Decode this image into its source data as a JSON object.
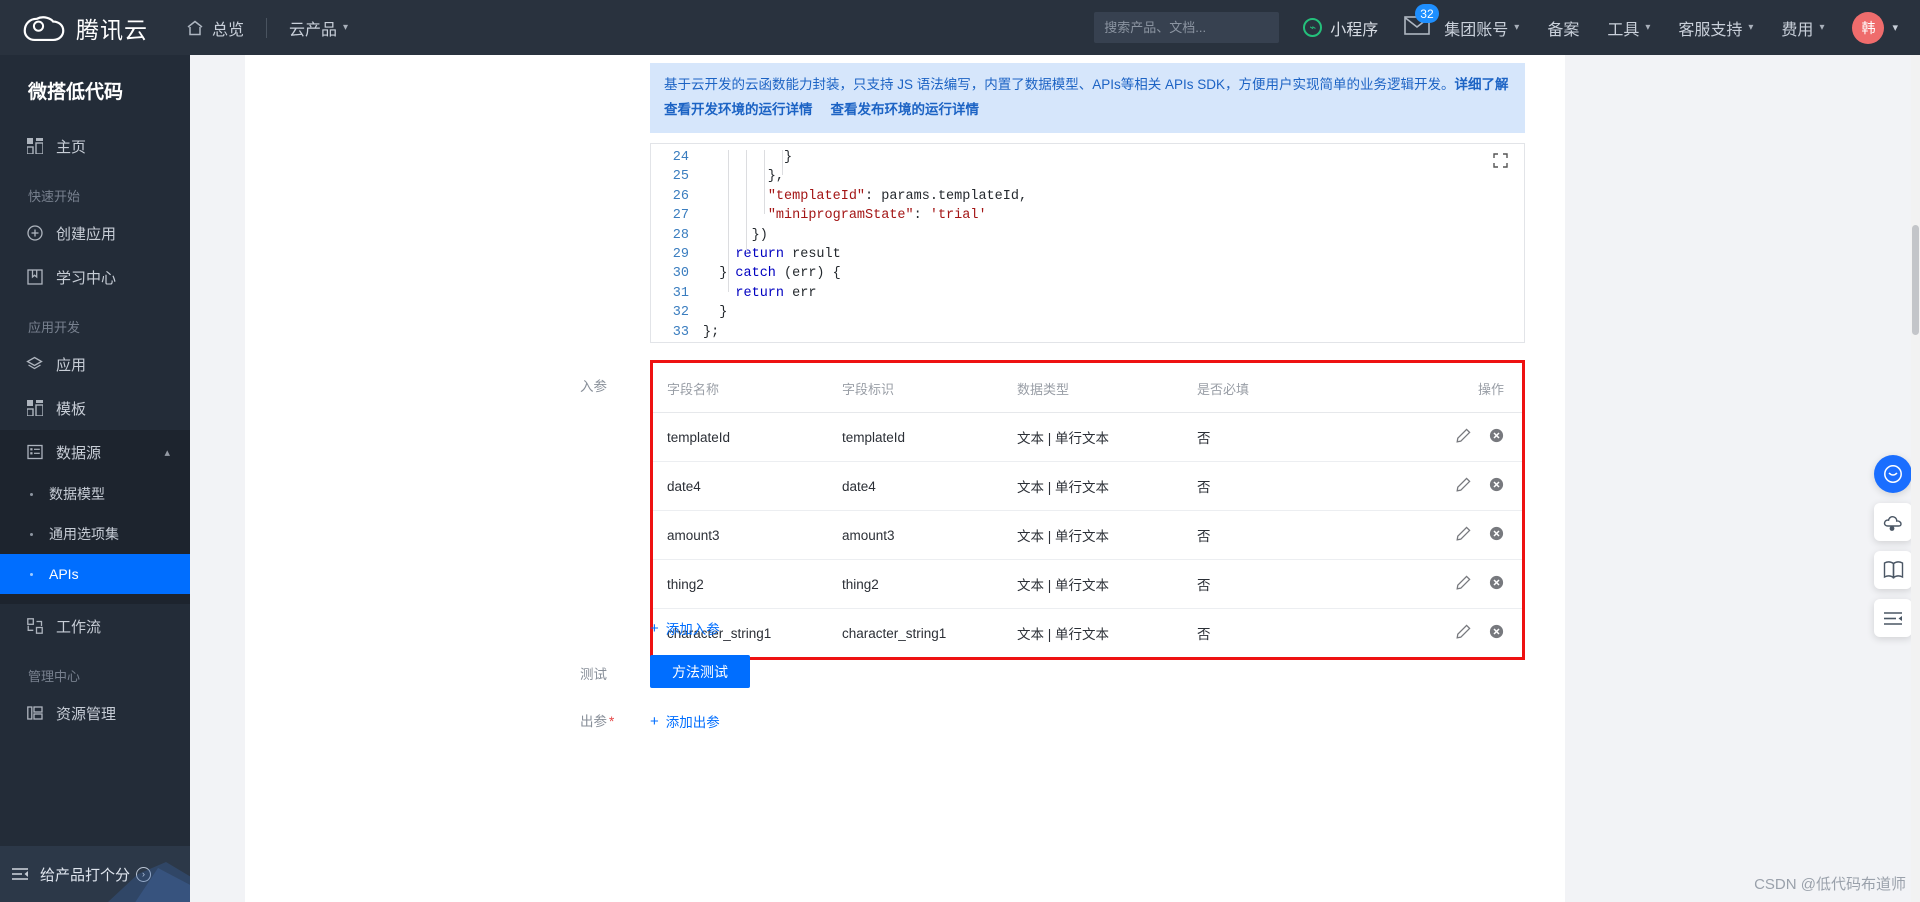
{
  "header": {
    "brand": "腾讯云",
    "home": "总览",
    "products": "云产品",
    "search_placeholder": "搜索产品、文档...",
    "miniprogram": "小程序",
    "mail_badge": "32",
    "group_account": "集团账号",
    "beian": "备案",
    "tools": "工具",
    "support": "客服支持",
    "fee": "费用",
    "avatar_text": "韩"
  },
  "sidebar": {
    "title": "微搭低代码",
    "home": "主页",
    "group_quickstart": "快速开始",
    "create_app": "创建应用",
    "learn_center": "学习中心",
    "group_appdev": "应用开发",
    "app": "应用",
    "template": "模板",
    "datasource": "数据源",
    "data_model": "数据模型",
    "option_set": "通用选项集",
    "apis": "APIs",
    "workflow": "工作流",
    "group_manage": "管理中心",
    "resource_manage": "资源管理",
    "rate_product": "给产品打个分"
  },
  "notice": {
    "text": "基于云开发的云函数能力封装，只支持 JS 语法编写，内置了数据模型、APIs等相关 APIs SDK，方便用户实现简单的业务逻辑开发。",
    "detail_link": "详细了解",
    "dev_env_link": "查看开发环境的运行详情",
    "release_env_link": "查看发布环境的运行详情"
  },
  "code": {
    "lines": [
      {
        "no": "24",
        "text": "          }"
      },
      {
        "no": "25",
        "text": "        },"
      },
      {
        "no": "26",
        "text": "        \"templateId\": params.templateId,"
      },
      {
        "no": "27",
        "text": "        \"miniprogramState\": 'trial'"
      },
      {
        "no": "28",
        "text": "      })"
      },
      {
        "no": "29",
        "text": "    return result"
      },
      {
        "no": "30",
        "text": "  } catch (err) {"
      },
      {
        "no": "31",
        "text": "    return err"
      },
      {
        "no": "32",
        "text": "  }"
      },
      {
        "no": "33",
        "text": "};"
      }
    ]
  },
  "params": {
    "label": "入参",
    "columns": [
      "字段名称",
      "字段标识",
      "数据类型",
      "是否必填",
      "操作"
    ],
    "rows": [
      {
        "name": "templateId",
        "key": "templateId",
        "type": "文本 | 单行文本",
        "required": "否"
      },
      {
        "name": "date4",
        "key": "date4",
        "type": "文本 | 单行文本",
        "required": "否"
      },
      {
        "name": "amount3",
        "key": "amount3",
        "type": "文本 | 单行文本",
        "required": "否"
      },
      {
        "name": "thing2",
        "key": "thing2",
        "type": "文本 | 单行文本",
        "required": "否"
      },
      {
        "name": "character_string1",
        "key": "character_string1",
        "type": "文本 | 单行文本",
        "required": "否"
      }
    ],
    "add_label": "添加入参"
  },
  "test": {
    "label": "测试",
    "button": "方法测试"
  },
  "output": {
    "label": "出参",
    "add_label": "添加出参"
  },
  "watermark": "CSDN @低代码布道师",
  "colors": {
    "accent": "#006eff",
    "header_bg": "#29323e",
    "sidebar_bg": "#232c38",
    "highlight_border": "#ee1111",
    "notice_bg": "#d6e6fb",
    "notice_fg": "#1c63c4"
  }
}
